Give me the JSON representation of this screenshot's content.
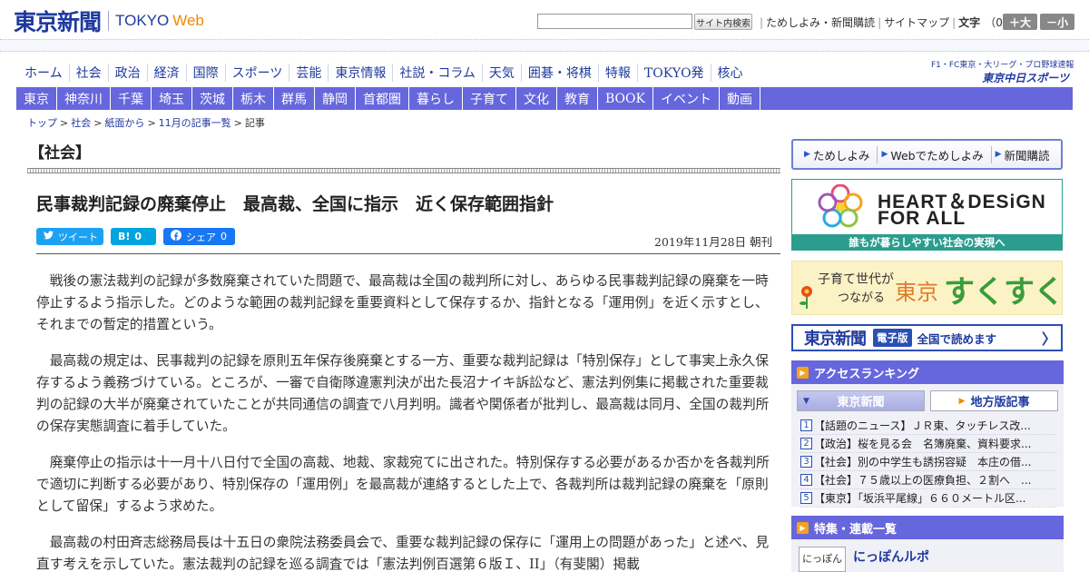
{
  "header": {
    "logo_jp": "東京新聞",
    "logo_en": "TOKYO",
    "logo_web": "Web",
    "search_button": "サイト内検索",
    "top_links": [
      "ためしよみ・新聞購読",
      "サイトマップ"
    ],
    "font_size_label": "文字",
    "font_size_value": "（0）",
    "font_plus": "＋大",
    "font_minus": "－小"
  },
  "main_nav": [
    "ホーム",
    "社会",
    "政治",
    "経済",
    "国際",
    "スポーツ",
    "芸能",
    "東京情報",
    "社説・コラム",
    "天気",
    "囲碁・将棋",
    "特報",
    "TOKYO発",
    "核心"
  ],
  "chunichi_banner": {
    "small": "F1・FC東京・大リーグ・プロ野球速報",
    "label": "東京中日スポーツ"
  },
  "region_nav": [
    "東京",
    "神奈川",
    "千葉",
    "埼玉",
    "茨城",
    "栃木",
    "群馬",
    "静岡",
    "首都圏",
    "暮らし",
    "子育て",
    "文化",
    "教育",
    "BOOK",
    "イベント",
    "動画"
  ],
  "breadcrumb": [
    "トップ",
    "社会",
    "紙面から",
    "11月の記事一覧"
  ],
  "breadcrumb_current": "記事",
  "article": {
    "section": "【社会】",
    "headline": "民事裁判記録の廃棄停止　最高裁、全国に指示　近く保存範囲指針",
    "share": {
      "tweet": "ツイート",
      "hatena_label": "B!",
      "hatena_count": "0",
      "facebook": "シェア",
      "facebook_count": "0"
    },
    "date": "2019年11月28日 朝刊",
    "paragraphs": [
      "戦後の憲法裁判の記録が多数廃棄されていた問題で、最高裁は全国の裁判所に対し、あらゆる民事裁判記録の廃棄を一時停止するよう指示した。どのような範囲の裁判記録を重要資料として保存するか、指針となる「運用例」を近く示すとし、それまでの暫定的措置という。",
      "最高裁の規定は、民事裁判の記録を原則五年保存後廃棄とする一方、重要な裁判記録は「特別保存」として事実上永久保存するよう義務づけている。ところが、一審で自衛隊違憲判決が出た長沼ナイキ訴訟など、憲法判例集に掲載された重要裁判の記録の大半が廃棄されていたことが共同通信の調査で八月判明。識者や関係者が批判し、最高裁は同月、全国の裁判所の保存実態調査に着手していた。",
      "廃棄停止の指示は十一月十八日付で全国の高裁、地裁、家裁宛てに出された。特別保存する必要があるか否かを各裁判所で適切に判断する必要があり、特別保存の「運用例」を最高裁が連絡するとした上で、各裁判所は裁判記録の廃棄を「原則として留保」するよう求めた。",
      "最高裁の村田斉志総務局長は十五日の衆院法務委員会で、重要な裁判記録の保存に「運用上の問題があった」と述べ、見直す考えを示していた。憲法裁判の記録を巡る調査では「憲法判例百選第６版Ｉ、II」（有斐閣）掲載"
    ]
  },
  "sidebar": {
    "promo_links": [
      "ためしよみ",
      "Webでためしよみ",
      "新聞購読"
    ],
    "heart_title_1": "HEART＆DESiGN",
    "heart_title_2": "FOR ALL",
    "heart_caption": "誰もが暮らしやすい社会の実現へ",
    "sukusuku_small_1": "子育て世代が",
    "sukusuku_small_2": "つながる",
    "sukusuku_tokyo": "東京",
    "sukusuku_main": "すくすく",
    "edition_logo": "東京新聞",
    "edition_tag": "電子版",
    "edition_text": "全国で読めます",
    "ranking_title": "アクセスランキング",
    "ranking_tab_a": "東京新聞",
    "ranking_tab_b": "地方版記事",
    "ranking": [
      {
        "rank": "1",
        "text": "【話題のニュース】ＪＲ東、タッチレス改..."
      },
      {
        "rank": "2",
        "text": "【政治】桜を見る会　名簿廃棄、資料要求..."
      },
      {
        "rank": "3",
        "text": "【社会】別の中学生も誘拐容疑　本庄の借..."
      },
      {
        "rank": "4",
        "text": "【社会】７５歳以上の医療負担、２割へ　..."
      },
      {
        "rank": "5",
        "text": "【東京】「坂浜平尾線」６６０メートル区..."
      }
    ],
    "feature_title": "特集・連載一覧",
    "feature_thumb": "にっぽん",
    "feature_item": "にっぽんルポ"
  },
  "colors": {
    "brand": "#1f3a9e",
    "nav_purple": "#6666dd",
    "accent_orange": "#f08a00",
    "teal": "#2a9d8f",
    "green": "#3a9d3a"
  }
}
